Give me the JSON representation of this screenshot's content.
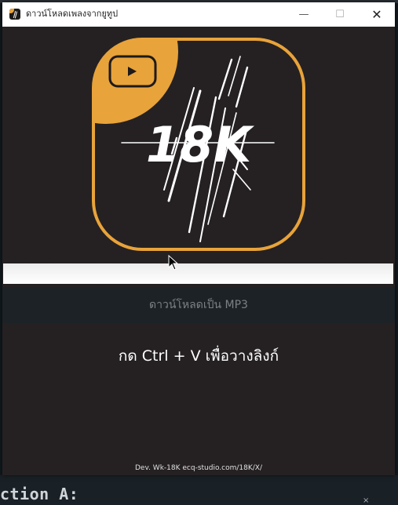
{
  "window": {
    "title": "ดาวน์โหลดเพลงจากยูทูป",
    "minimize_glyph": "—",
    "maximize_glyph": "☐",
    "close_glyph": "✕"
  },
  "logo": {
    "text": "18K",
    "icon": "youtube-play-icon",
    "accent_color": "#e8a33a"
  },
  "url_input": {
    "value": "",
    "placeholder": ""
  },
  "download_button": {
    "label": "ดาวน์โหลดเป็น MP3"
  },
  "hint": {
    "text": "กด Ctrl + V เพื่อวางลิงก์"
  },
  "footer": {
    "credit": "Dev. Wk-18K ecq-studio.com/18K/X/"
  },
  "background": {
    "terminal_text": "ction A:",
    "close_glyph": "×"
  },
  "colors": {
    "window_bg": "#252122",
    "button_bg": "#1c2226",
    "button_text": "#7b8185",
    "accent": "#e8a33a"
  }
}
